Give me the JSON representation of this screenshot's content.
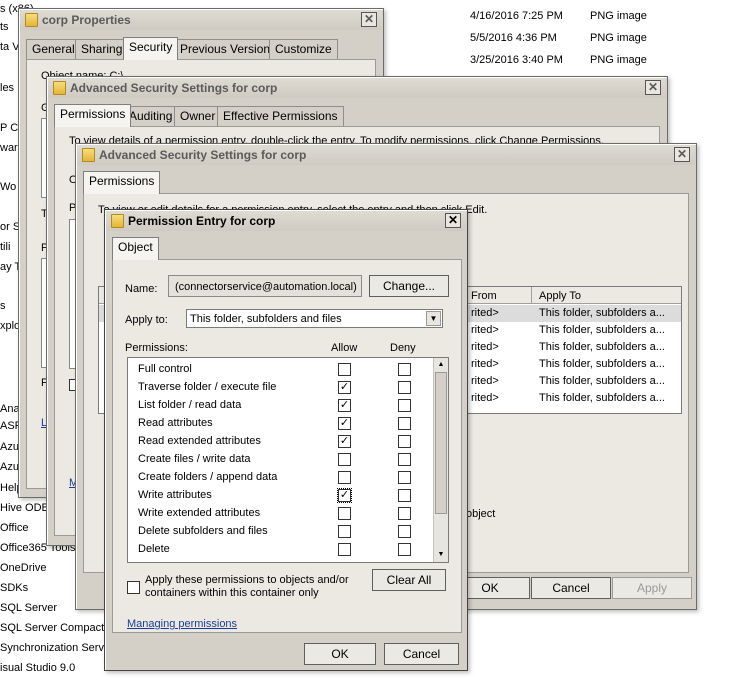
{
  "explorer": {
    "tree_items": [
      "s (x86)",
      "ts",
      "ta Ve",
      "les",
      "P C",
      "war",
      "Wo",
      "or S",
      "tili",
      "ay T",
      "s",
      "xplo",
      "Ana",
      "ASP",
      "Azu",
      "Azu",
      "Help Viewe",
      "Hive ODB",
      "Office",
      "Office365 Tools",
      "OneDrive",
      "SDKs",
      "SQL Server",
      "SQL Server Compact E",
      "Synchronization Servic",
      "isual Studio 9.0"
    ],
    "files": [
      {
        "date": "4/16/2016 7:25 PM",
        "type": "PNG image"
      },
      {
        "date": "5/5/2016 4:36 PM",
        "type": "PNG image"
      },
      {
        "date": "3/25/2016 3:40 PM",
        "type": "PNG image"
      }
    ]
  },
  "props": {
    "title": "corp Properties",
    "tabs": [
      "General",
      "Sharing",
      "Security",
      "Previous Versions",
      "Customize"
    ],
    "fragments": [
      "Object name:   C:\\",
      "G",
      "C",
      "T",
      "P",
      "F",
      "L"
    ]
  },
  "adv1": {
    "title": "Advanced Security Settings for corp",
    "tabs": [
      "Permissions",
      "Auditing",
      "Owner",
      "Effective Permissions"
    ],
    "intro": "To view details of a permission entry, double-click the entry. To modify permissions, click Change Permissions.",
    "fragments": [
      "O",
      "P",
      "F",
      "L",
      "M"
    ]
  },
  "adv2": {
    "title": "Advanced Security Settings for corp",
    "tab": "Permissions",
    "intro": "To view or edit details for a permission entry, select the entry and then click Edit.",
    "columns": [
      "From",
      "Apply To"
    ],
    "rows": [
      {
        "from": "rited>",
        "apply": "This folder, subfolders a..."
      },
      {
        "from": "rited>",
        "apply": "This folder, subfolders a..."
      },
      {
        "from": "rited>",
        "apply": "This folder, subfolders a..."
      },
      {
        "from": "rited>",
        "apply": "This folder, subfolders a..."
      },
      {
        "from": "rited>",
        "apply": "This folder, subfolders a..."
      },
      {
        "from": "rited>",
        "apply": "This folder, subfolders a..."
      }
    ],
    "object_fragment": "object",
    "ok": "OK",
    "cancel": "Cancel",
    "apply": "Apply"
  },
  "entry": {
    "title": "Permission Entry for corp",
    "tab": "Object",
    "name_label": "Name:",
    "name_value": "(connectorservice@automation.local)",
    "change_button": "Change...",
    "apply_to_label": "Apply to:",
    "apply_to_value": "This folder, subfolders and files",
    "permissions_label": "Permissions:",
    "allow_header": "Allow",
    "deny_header": "Deny",
    "permissions": [
      {
        "name": "Full control",
        "allow": false,
        "deny": false
      },
      {
        "name": "Traverse folder / execute file",
        "allow": true,
        "deny": false
      },
      {
        "name": "List folder / read data",
        "allow": true,
        "deny": false
      },
      {
        "name": "Read attributes",
        "allow": true,
        "deny": false
      },
      {
        "name": "Read extended attributes",
        "allow": true,
        "deny": false
      },
      {
        "name": "Create files / write data",
        "allow": false,
        "deny": false
      },
      {
        "name": "Create folders / append data",
        "allow": false,
        "deny": false
      },
      {
        "name": "Write attributes",
        "allow": true,
        "deny": false
      },
      {
        "name": "Write extended attributes",
        "allow": false,
        "deny": false
      },
      {
        "name": "Delete subfolders and files",
        "allow": false,
        "deny": false
      },
      {
        "name": "Delete",
        "allow": false,
        "deny": false
      }
    ],
    "apply_inherit_label": "Apply these permissions to objects and/or containers within this container only",
    "clear_all": "Clear All",
    "managing_link": "Managing permissions",
    "ok": "OK",
    "cancel": "Cancel"
  }
}
